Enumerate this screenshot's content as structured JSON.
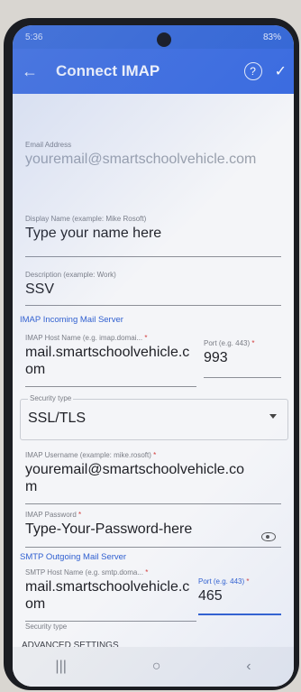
{
  "status": {
    "time": "5:36",
    "battery": "83%"
  },
  "header": {
    "title": "Connect IMAP",
    "help_icon": "?",
    "confirm_icon": "✓",
    "back_icon": "←"
  },
  "fields": {
    "email": {
      "label": "Email Address",
      "value": "youremail@smartschoolvehicle.com"
    },
    "display_name": {
      "label": "Display Name (example: Mike Rosoft)",
      "value": "Type your name here"
    },
    "description": {
      "label": "Description (example: Work)",
      "value": "SSV"
    }
  },
  "imap": {
    "section_title": "IMAP Incoming Mail Server",
    "host_label": "IMAP Host Name (e.g. imap.domai...",
    "host_value": "mail.smartschoolvehicle.com",
    "port_label": "Port (e.g. 443)",
    "port_value": "993",
    "security_label": "Security type",
    "security_value": "SSL/TLS",
    "username_label": "IMAP Username (example: mike.rosoft)",
    "username_value": "youremail@smartschoolvehicle.com",
    "password_label": "IMAP Password",
    "password_value": "Type-Your-Password-here"
  },
  "smtp": {
    "section_title": "SMTP Outgoing Mail Server",
    "host_label": "SMTP Host Name (e.g. smtp.doma...",
    "host_value": "mail.smartschoolvehicle.com",
    "port_label": "Port (e.g. 443)",
    "port_value": "465",
    "security_label": "Security type"
  },
  "advanced": {
    "label": "ADVANCED SETTINGS",
    "enabled": true
  },
  "navbar": {
    "recent": "|||",
    "home": "○",
    "back": "‹"
  },
  "colors": {
    "accent": "#3a6be0",
    "required": "#d23b3b"
  }
}
